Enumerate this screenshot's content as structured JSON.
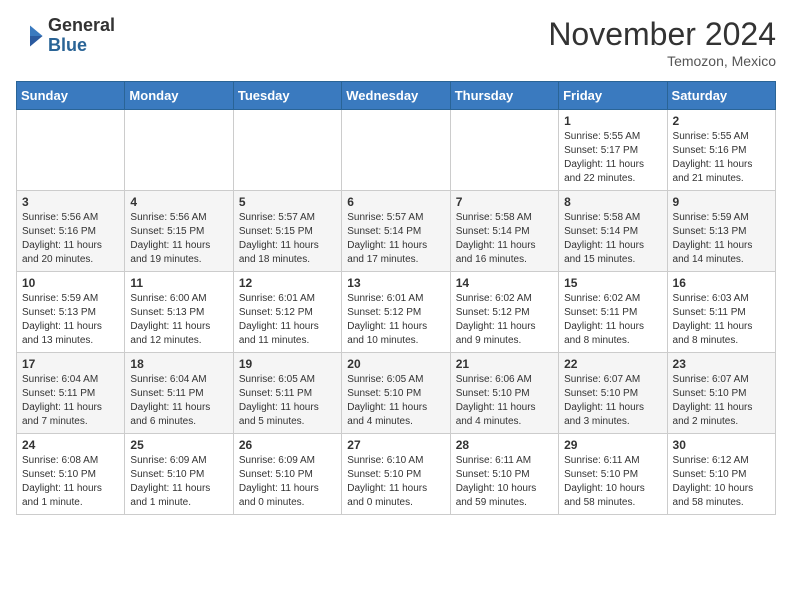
{
  "logo": {
    "general": "General",
    "blue": "Blue"
  },
  "title": "November 2024",
  "location": "Temozon, Mexico",
  "days_header": [
    "Sunday",
    "Monday",
    "Tuesday",
    "Wednesday",
    "Thursday",
    "Friday",
    "Saturday"
  ],
  "weeks": [
    [
      {
        "day": "",
        "sunrise": "",
        "sunset": "",
        "daylight": ""
      },
      {
        "day": "",
        "sunrise": "",
        "sunset": "",
        "daylight": ""
      },
      {
        "day": "",
        "sunrise": "",
        "sunset": "",
        "daylight": ""
      },
      {
        "day": "",
        "sunrise": "",
        "sunset": "",
        "daylight": ""
      },
      {
        "day": "",
        "sunrise": "",
        "sunset": "",
        "daylight": ""
      },
      {
        "day": "1",
        "sunrise": "Sunrise: 5:55 AM",
        "sunset": "Sunset: 5:17 PM",
        "daylight": "Daylight: 11 hours and 22 minutes."
      },
      {
        "day": "2",
        "sunrise": "Sunrise: 5:55 AM",
        "sunset": "Sunset: 5:16 PM",
        "daylight": "Daylight: 11 hours and 21 minutes."
      }
    ],
    [
      {
        "day": "3",
        "sunrise": "Sunrise: 5:56 AM",
        "sunset": "Sunset: 5:16 PM",
        "daylight": "Daylight: 11 hours and 20 minutes."
      },
      {
        "day": "4",
        "sunrise": "Sunrise: 5:56 AM",
        "sunset": "Sunset: 5:15 PM",
        "daylight": "Daylight: 11 hours and 19 minutes."
      },
      {
        "day": "5",
        "sunrise": "Sunrise: 5:57 AM",
        "sunset": "Sunset: 5:15 PM",
        "daylight": "Daylight: 11 hours and 18 minutes."
      },
      {
        "day": "6",
        "sunrise": "Sunrise: 5:57 AM",
        "sunset": "Sunset: 5:14 PM",
        "daylight": "Daylight: 11 hours and 17 minutes."
      },
      {
        "day": "7",
        "sunrise": "Sunrise: 5:58 AM",
        "sunset": "Sunset: 5:14 PM",
        "daylight": "Daylight: 11 hours and 16 minutes."
      },
      {
        "day": "8",
        "sunrise": "Sunrise: 5:58 AM",
        "sunset": "Sunset: 5:14 PM",
        "daylight": "Daylight: 11 hours and 15 minutes."
      },
      {
        "day": "9",
        "sunrise": "Sunrise: 5:59 AM",
        "sunset": "Sunset: 5:13 PM",
        "daylight": "Daylight: 11 hours and 14 minutes."
      }
    ],
    [
      {
        "day": "10",
        "sunrise": "Sunrise: 5:59 AM",
        "sunset": "Sunset: 5:13 PM",
        "daylight": "Daylight: 11 hours and 13 minutes."
      },
      {
        "day": "11",
        "sunrise": "Sunrise: 6:00 AM",
        "sunset": "Sunset: 5:13 PM",
        "daylight": "Daylight: 11 hours and 12 minutes."
      },
      {
        "day": "12",
        "sunrise": "Sunrise: 6:01 AM",
        "sunset": "Sunset: 5:12 PM",
        "daylight": "Daylight: 11 hours and 11 minutes."
      },
      {
        "day": "13",
        "sunrise": "Sunrise: 6:01 AM",
        "sunset": "Sunset: 5:12 PM",
        "daylight": "Daylight: 11 hours and 10 minutes."
      },
      {
        "day": "14",
        "sunrise": "Sunrise: 6:02 AM",
        "sunset": "Sunset: 5:12 PM",
        "daylight": "Daylight: 11 hours and 9 minutes."
      },
      {
        "day": "15",
        "sunrise": "Sunrise: 6:02 AM",
        "sunset": "Sunset: 5:11 PM",
        "daylight": "Daylight: 11 hours and 8 minutes."
      },
      {
        "day": "16",
        "sunrise": "Sunrise: 6:03 AM",
        "sunset": "Sunset: 5:11 PM",
        "daylight": "Daylight: 11 hours and 8 minutes."
      }
    ],
    [
      {
        "day": "17",
        "sunrise": "Sunrise: 6:04 AM",
        "sunset": "Sunset: 5:11 PM",
        "daylight": "Daylight: 11 hours and 7 minutes."
      },
      {
        "day": "18",
        "sunrise": "Sunrise: 6:04 AM",
        "sunset": "Sunset: 5:11 PM",
        "daylight": "Daylight: 11 hours and 6 minutes."
      },
      {
        "day": "19",
        "sunrise": "Sunrise: 6:05 AM",
        "sunset": "Sunset: 5:11 PM",
        "daylight": "Daylight: 11 hours and 5 minutes."
      },
      {
        "day": "20",
        "sunrise": "Sunrise: 6:05 AM",
        "sunset": "Sunset: 5:10 PM",
        "daylight": "Daylight: 11 hours and 4 minutes."
      },
      {
        "day": "21",
        "sunrise": "Sunrise: 6:06 AM",
        "sunset": "Sunset: 5:10 PM",
        "daylight": "Daylight: 11 hours and 4 minutes."
      },
      {
        "day": "22",
        "sunrise": "Sunrise: 6:07 AM",
        "sunset": "Sunset: 5:10 PM",
        "daylight": "Daylight: 11 hours and 3 minutes."
      },
      {
        "day": "23",
        "sunrise": "Sunrise: 6:07 AM",
        "sunset": "Sunset: 5:10 PM",
        "daylight": "Daylight: 11 hours and 2 minutes."
      }
    ],
    [
      {
        "day": "24",
        "sunrise": "Sunrise: 6:08 AM",
        "sunset": "Sunset: 5:10 PM",
        "daylight": "Daylight: 11 hours and 1 minute."
      },
      {
        "day": "25",
        "sunrise": "Sunrise: 6:09 AM",
        "sunset": "Sunset: 5:10 PM",
        "daylight": "Daylight: 11 hours and 1 minute."
      },
      {
        "day": "26",
        "sunrise": "Sunrise: 6:09 AM",
        "sunset": "Sunset: 5:10 PM",
        "daylight": "Daylight: 11 hours and 0 minutes."
      },
      {
        "day": "27",
        "sunrise": "Sunrise: 6:10 AM",
        "sunset": "Sunset: 5:10 PM",
        "daylight": "Daylight: 11 hours and 0 minutes."
      },
      {
        "day": "28",
        "sunrise": "Sunrise: 6:11 AM",
        "sunset": "Sunset: 5:10 PM",
        "daylight": "Daylight: 10 hours and 59 minutes."
      },
      {
        "day": "29",
        "sunrise": "Sunrise: 6:11 AM",
        "sunset": "Sunset: 5:10 PM",
        "daylight": "Daylight: 10 hours and 58 minutes."
      },
      {
        "day": "30",
        "sunrise": "Sunrise: 6:12 AM",
        "sunset": "Sunset: 5:10 PM",
        "daylight": "Daylight: 10 hours and 58 minutes."
      }
    ]
  ]
}
